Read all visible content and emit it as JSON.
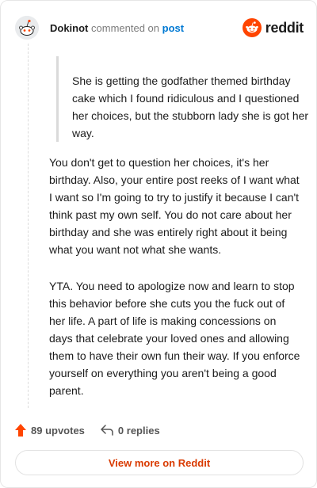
{
  "header": {
    "username": "Dokinot",
    "commented_text": "commented on",
    "post_link": "post",
    "brand": "reddit"
  },
  "comment": {
    "quote": "She is getting the godfather themed birthday cake which I found ridiculous and I questioned her choices, but the stubborn lady she is got her way.",
    "paragraphs": [
      "You don't get to question her choices, it's her birthday. Also, your entire post reeks of I want what I want so I'm going to try to justify it because I can't think past my own self. You do not care about her birthday and she was entirely right about it being what you want not what she wants.",
      "YTA. You need to apologize now and learn to stop this behavior before she cuts you the fuck out of her life. A part of life is making concessions on days that celebrate your loved ones and allowing them to have their own fun their way. If you enforce yourself on everything you aren't being a good parent."
    ]
  },
  "footer": {
    "upvotes": "89 upvotes",
    "replies": "0 replies",
    "view_more": "View more on Reddit"
  },
  "colors": {
    "brand": "#ff4500",
    "link": "#0079d3",
    "view_more": "#d93a00"
  },
  "icons": {
    "avatar": "snoo-avatar-icon",
    "logo": "reddit-logo-icon",
    "upvote": "upvote-arrow-icon",
    "reply": "reply-arrow-icon"
  }
}
